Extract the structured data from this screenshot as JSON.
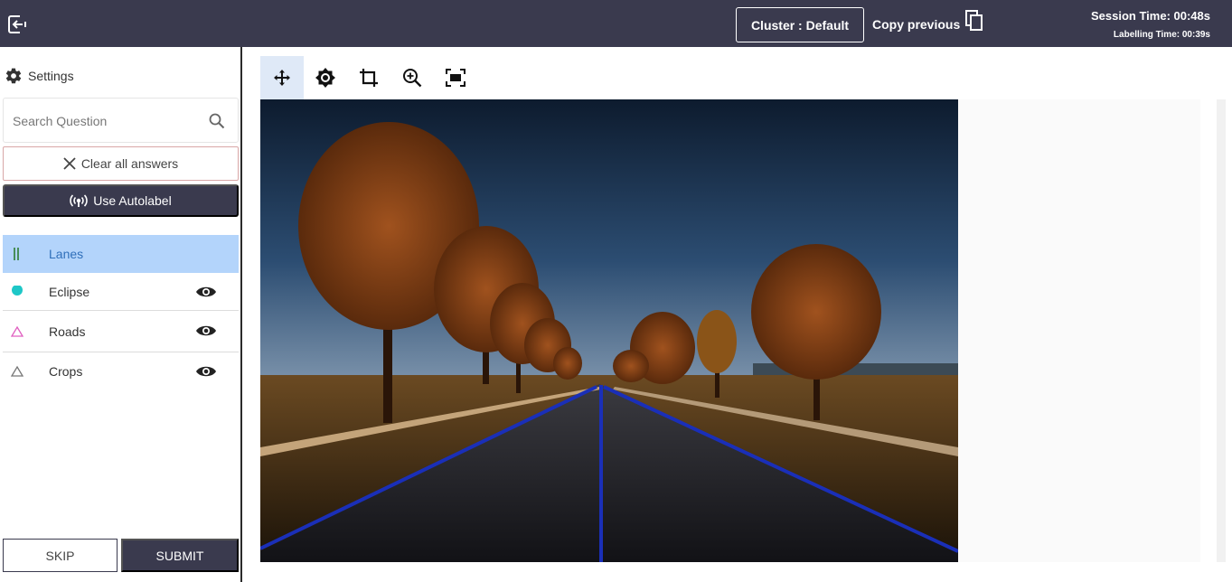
{
  "topbar": {
    "cluster_label": "Cluster : Default",
    "copy_previous_label": "Copy previous",
    "session_time": "Session Time: 00:48s",
    "labelling_time": "Labelling Time: 00:39s"
  },
  "sidebar": {
    "settings_label": "Settings",
    "search_placeholder": "Search Question",
    "clear_label": "Clear all answers",
    "autolabel_label": "Use Autolabel",
    "classes": [
      {
        "label": "Lanes",
        "icon": "lane-icon",
        "color": "#2e7d32"
      },
      {
        "label": "Eclipse",
        "icon": "circle-icon",
        "color": "#1ec7c7"
      },
      {
        "label": "Roads",
        "icon": "triangle-icon",
        "color": "#e05fc0"
      },
      {
        "label": "Crops",
        "icon": "triangle-icon",
        "color": "#777777"
      }
    ],
    "skip_label": "SKIP",
    "submit_label": "SUBMIT"
  },
  "toolbar": {
    "tools": [
      "move-icon",
      "brightness-icon",
      "crop-icon",
      "zoom-in-icon",
      "fit-screen-icon"
    ]
  },
  "colors": {
    "header_bg": "#3a3a4e",
    "active_class_bg": "#b3d4fb",
    "lane_annotation": "#1a2fb8"
  }
}
